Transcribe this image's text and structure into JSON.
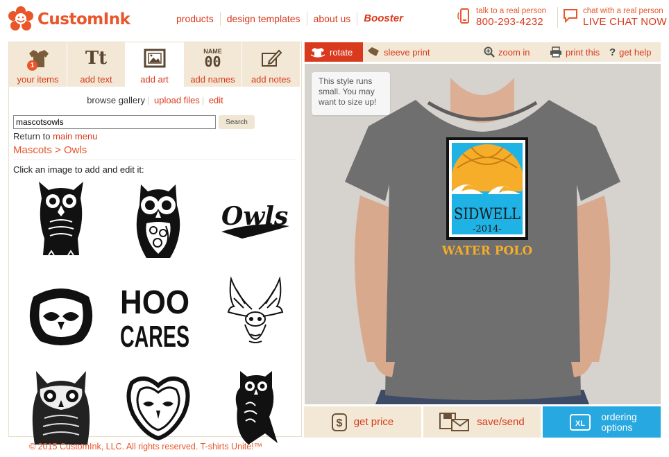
{
  "brand": {
    "name": "CustomInk",
    "accent": "#e8562a",
    "link": "#d9391c"
  },
  "topnav": {
    "products": "products",
    "design_templates": "design templates",
    "about_us": "about us",
    "booster": "Booster"
  },
  "contact": {
    "phone_small": "talk to a real person",
    "phone_number": "800-293-4232",
    "chat_small": "chat with a real person",
    "chat_big": "LIVE CHAT NOW"
  },
  "tabs": [
    {
      "label": "your items",
      "icon": "tshirt-icon",
      "badge": "1"
    },
    {
      "label": "add text",
      "icon": "text-tt-icon",
      "glyph": "Tt"
    },
    {
      "label": "add art",
      "icon": "picture-frame-icon"
    },
    {
      "label": "add names",
      "icon": "name-number-icon",
      "top": "NAME",
      "num": "00"
    },
    {
      "label": "add notes",
      "icon": "pencil-note-icon"
    }
  ],
  "subnav": {
    "browse": "browse gallery",
    "upload": "upload files",
    "edit": "edit"
  },
  "search": {
    "value": "mascotsowls",
    "button": "Search"
  },
  "return": {
    "prefix": "Return to",
    "link": "main menu"
  },
  "breadcrumb": "Mascots > Owls",
  "instruction": "Click an image to add and edit it:",
  "gallery": [
    "owl-sketch-icon",
    "owl-ornate-icon",
    "owls-script-icon",
    "owl-face-icon",
    "hoo-cares-icon",
    "owl-spread-wings-icon",
    "owl-engraved-icon",
    "owl-heart-face-icon",
    "owl-silhouette-icon"
  ],
  "gallery_text": {
    "owls_script": "Owls",
    "hoo": "HOO",
    "cares": "CARES"
  },
  "toolbar": {
    "rotate": "rotate",
    "sleeve": "sleeve print",
    "zoom": "zoom in",
    "print": "print this",
    "help": "get help"
  },
  "tooltip": "This style runs small. You may want to size up!",
  "design": {
    "school": "SIDWELL",
    "year": "-2014-",
    "sport": "WATER POLO",
    "shirt_color": "#6f6f6f",
    "orange": "#f6ad2a",
    "blue": "#1fb2e4"
  },
  "bottom": {
    "price": "get price",
    "save": "save/send",
    "order_line1": "ordering",
    "order_line2": "options",
    "xl": "XL"
  },
  "footer": "© 2015 CustomInk, LLC. All rights reserved.   T-shirts Unite!™"
}
